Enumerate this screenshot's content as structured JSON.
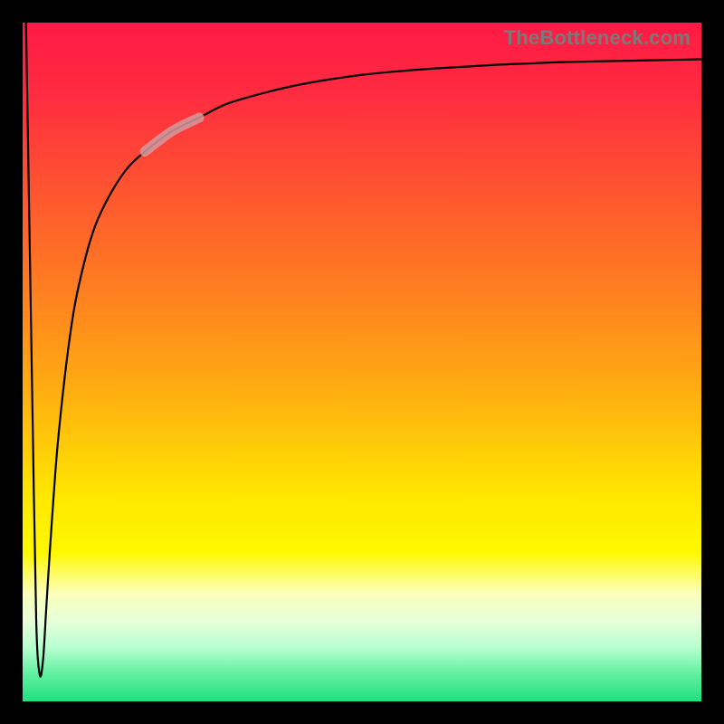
{
  "watermark": "TheBottleneck.com",
  "chart_data": {
    "type": "line",
    "title": "",
    "xlabel": "",
    "ylabel": "",
    "xlim": [
      0,
      100
    ],
    "ylim": [
      0,
      100
    ],
    "grid": false,
    "legend": false,
    "background_gradient": {
      "top_color": "#ff1a45",
      "mid_color": "#ffe800",
      "bottom_color": "#20e080"
    },
    "series": [
      {
        "name": "bottleneck-curve",
        "color": "#000000",
        "x": [
          0.5,
          1.0,
          1.5,
          2.0,
          2.5,
          3.0,
          3.5,
          4.0,
          5,
          6,
          7,
          8,
          10,
          12,
          15,
          18,
          22,
          26,
          30,
          35,
          40,
          45,
          50,
          55,
          60,
          65,
          70,
          75,
          80,
          85,
          90,
          95,
          100
        ],
        "y": [
          100,
          70,
          40,
          12,
          4,
          6,
          14,
          22,
          36,
          46,
          54,
          60,
          68,
          73,
          78,
          81,
          84,
          86,
          88,
          89.5,
          90.7,
          91.6,
          92.3,
          92.8,
          93.2,
          93.5,
          93.8,
          94.0,
          94.2,
          94.3,
          94.4,
          94.5,
          94.6
        ]
      }
    ],
    "highlight_segment": {
      "x_range": [
        18,
        26
      ],
      "color": "#d49aa0",
      "width": 11
    },
    "notes": "Values are estimated from the raster; x and y expressed as 0–100 fractions of the plot area. y=0 at bottom (green), y=100 at top (red)."
  }
}
